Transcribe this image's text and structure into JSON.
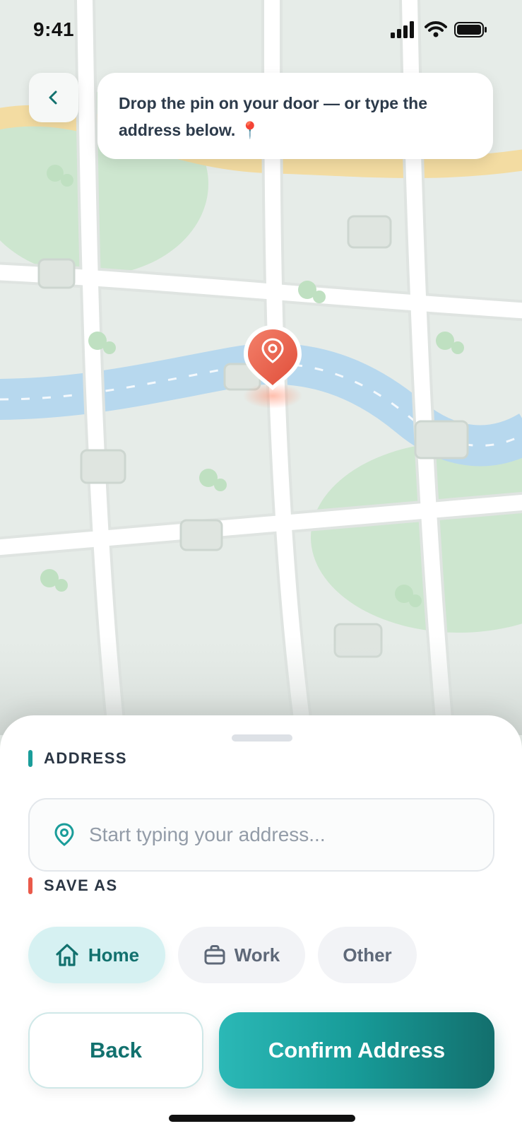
{
  "status_bar": {
    "time": "9:41"
  },
  "header": {
    "back_icon": "chevron-left-icon",
    "hint_text": "Drop the pin on your door — or type the address below.",
    "hint_emoji": "📍"
  },
  "map": {
    "pin_icon": "map-pin-icon",
    "pin_color": "#e9604c"
  },
  "sheet": {
    "address_label": "ADDRESS",
    "address_accent": "#1a9d9a",
    "address_placeholder": "Start typing your address...",
    "address_value": "",
    "save_as_label": "SAVE AS",
    "save_as_accent": "#ea5a4a",
    "options": [
      {
        "label": "Home",
        "icon": "home-icon",
        "selected": true
      },
      {
        "label": "Work",
        "icon": "briefcase-icon",
        "selected": false
      },
      {
        "label": "Other",
        "icon": "",
        "selected": false
      }
    ],
    "back_button": "Back",
    "confirm_button": "Confirm Address"
  },
  "colors": {
    "brand": "#12716e",
    "brand_light": "#d6f1f2",
    "accent": "#e9604c"
  }
}
